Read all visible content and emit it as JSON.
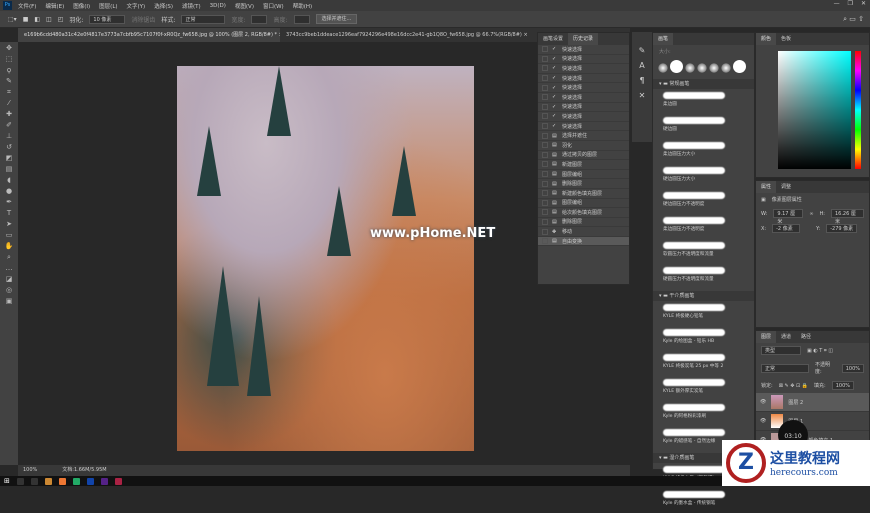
{
  "menu": {
    "logo": "Ps",
    "items": [
      "文件(F)",
      "编辑(E)",
      "图像(I)",
      "图层(L)",
      "文字(Y)",
      "选择(S)",
      "滤镜(T)",
      "3D(D)",
      "视图(V)",
      "窗口(W)",
      "帮助(H)"
    ],
    "min": "—",
    "restore": "❐",
    "close": "✕"
  },
  "options": {
    "feather_label": "羽化:",
    "feather_value": "10 像素",
    "antialias": "消除锯齿",
    "style_label": "样式:",
    "style_value": "正常",
    "width_label": "宽度:",
    "height_label": "高度:",
    "select_mask": "选择并遮住..."
  },
  "tabs": [
    {
      "label": "e169b6cdd480a31c42e0f4817e3773a7cbfb95c7107f0f-xR0Qz_fw658.jpg @ 100% (图层 2, RGB/8#) * ×"
    },
    {
      "label": "3743cc9beb1ddeace1296eaf7924296e498e16dcc2e41-gb1Q8O_fw658.jpg @ 66.7%(RGB/8#) ×"
    }
  ],
  "watermark": "www.pHome.NET",
  "status": {
    "zoom": "100%",
    "doc": "文档:1.66M/5.95M"
  },
  "history": {
    "tabs": [
      "画笔设置",
      "历史记录"
    ],
    "items": [
      "快速选择",
      "快速选择",
      "快速选择",
      "快速选择",
      "快速选择",
      "快速选择",
      "快速选择",
      "快速选择",
      "快速选择",
      "选择并遮住",
      "羽化",
      "通过拷贝的图层",
      "新建图层",
      "图层编组",
      "删除图层",
      "新建颜色填充图层",
      "图层编组",
      "给次颜色填充图层",
      "删除图层",
      "移动",
      "自由变换"
    ]
  },
  "brushes": {
    "tab": "画笔",
    "size_label": "大小:",
    "groups": [
      {
        "name": "常规画笔",
        "items": [
          "柔边圆",
          "硬边圆",
          "柔边圆压力大小",
          "硬边圆压力大小",
          "硬边圆压力不透明度",
          "柔边圆压力不透明度",
          "软圆压力不透明度和流量",
          "硬圆压力不透明度和流量"
        ]
      },
      {
        "name": "干介质画笔",
        "items": [
          "KYLE 终极硬心铅笔",
          "Kyle 的绘图盒 - 铅乐 HB",
          "KYLE 终极炭笔 25 px 中等 2",
          "KYLE 额外厚实炭笔",
          "Kyle 的阿格粉彩漆刷",
          "Kyle 的蜡感笔 - 自然边缘"
        ]
      },
      {
        "name": "湿介质画笔",
        "items": [
          "KYLE 终极上墨（粗和细）",
          "Kyle 的墨水盒 - 传统钢笔"
        ]
      }
    ]
  },
  "color": {
    "tabs": [
      "颜色",
      "色板"
    ]
  },
  "properties": {
    "tabs": [
      "属性",
      "调整"
    ],
    "title": "像素图层属性",
    "w_label": "W:",
    "w": "9.17 厘米",
    "h_label": "H:",
    "h": "16.26 厘米",
    "x_label": "X:",
    "x": "-2 像素",
    "y_label": "Y:",
    "y": "-279 像素"
  },
  "layers": {
    "tabs": [
      "图层",
      "通道",
      "路径"
    ],
    "filter": "类型",
    "blend": "正常",
    "opacity_label": "不透明度:",
    "opacity": "100%",
    "lock_label": "锁定:",
    "fill_label": "填充:",
    "fill": "100%",
    "items": [
      "图层 2",
      "图层 1",
      "颜色填充 1"
    ]
  },
  "timer": "03:10",
  "logo": {
    "title": "这里教程网",
    "url": "herecours.com"
  }
}
